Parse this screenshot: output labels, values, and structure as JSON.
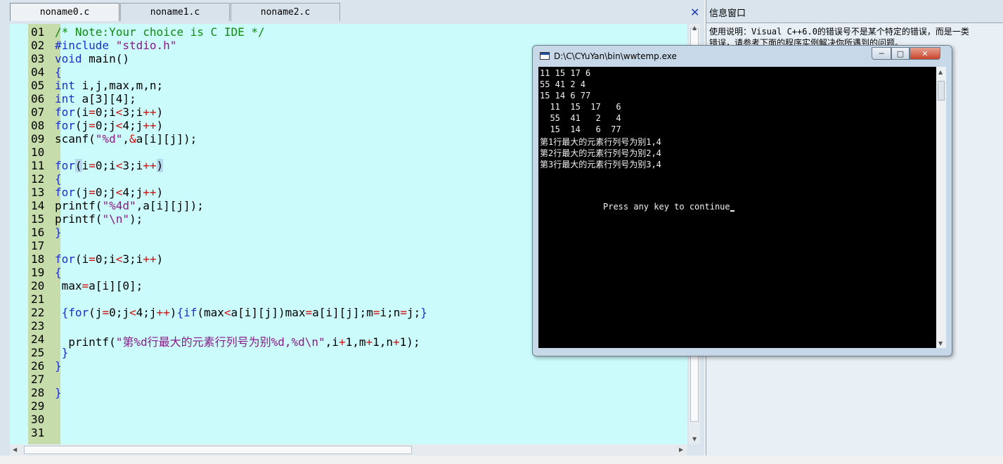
{
  "tabs": [
    {
      "label": "noname0.c"
    },
    {
      "label": "noname1.c"
    },
    {
      "label": "noname2.c"
    }
  ],
  "editor": {
    "line_numbers": [
      "01",
      "02",
      "03",
      "04",
      "05",
      "06",
      "07",
      "08",
      "09",
      "10",
      "11",
      "12",
      "13",
      "14",
      "15",
      "16",
      "17",
      "18",
      "19",
      "20",
      "21",
      "22",
      "23",
      "24",
      "25",
      "26",
      "27",
      "28",
      "29",
      "30",
      "31"
    ],
    "lines": [
      [
        {
          "t": "/* Note:Your choice is C IDE */",
          "c": "cm"
        }
      ],
      [
        {
          "t": "#include ",
          "c": "kw"
        },
        {
          "t": "\"stdio.h\"",
          "c": "str"
        }
      ],
      [
        {
          "t": "void",
          "c": "kw"
        },
        {
          "t": " main()",
          "c": "pl"
        }
      ],
      [
        {
          "t": "{",
          "c": "kw"
        }
      ],
      [
        {
          "t": "int",
          "c": "kw"
        },
        {
          "t": " i,j,max,m,n;",
          "c": "pl"
        }
      ],
      [
        {
          "t": "int",
          "c": "kw"
        },
        {
          "t": " a[3][4];",
          "c": "pl"
        }
      ],
      [
        {
          "t": "for",
          "c": "kw"
        },
        {
          "t": "(i",
          "c": "pl"
        },
        {
          "t": "=",
          "c": "op"
        },
        {
          "t": "0;i",
          "c": "pl"
        },
        {
          "t": "<",
          "c": "op"
        },
        {
          "t": "3;i",
          "c": "pl"
        },
        {
          "t": "++",
          "c": "op"
        },
        {
          "t": ")",
          "c": "pl"
        }
      ],
      [
        {
          "t": "for",
          "c": "kw"
        },
        {
          "t": "(j",
          "c": "pl"
        },
        {
          "t": "=",
          "c": "op"
        },
        {
          "t": "0;j",
          "c": "pl"
        },
        {
          "t": "<",
          "c": "op"
        },
        {
          "t": "4;j",
          "c": "pl"
        },
        {
          "t": "++",
          "c": "op"
        },
        {
          "t": ")",
          "c": "pl"
        }
      ],
      [
        {
          "t": "scanf(",
          "c": "pl"
        },
        {
          "t": "\"%d\"",
          "c": "str"
        },
        {
          "t": ",",
          "c": "pl"
        },
        {
          "t": "&",
          "c": "op"
        },
        {
          "t": "a[i][j]);",
          "c": "pl"
        }
      ],
      [],
      [
        {
          "t": "for",
          "c": "kw"
        },
        {
          "t": "(",
          "c": "hl"
        },
        {
          "t": "i",
          "c": "pl"
        },
        {
          "t": "=",
          "c": "op"
        },
        {
          "t": "0;i",
          "c": "pl"
        },
        {
          "t": "<",
          "c": "op"
        },
        {
          "t": "3;i",
          "c": "pl"
        },
        {
          "t": "++",
          "c": "op"
        },
        {
          "t": ")",
          "c": "hl"
        }
      ],
      [
        {
          "t": "{",
          "c": "kw"
        }
      ],
      [
        {
          "t": "for",
          "c": "kw"
        },
        {
          "t": "(j",
          "c": "pl"
        },
        {
          "t": "=",
          "c": "op"
        },
        {
          "t": "0;j",
          "c": "pl"
        },
        {
          "t": "<",
          "c": "op"
        },
        {
          "t": "4;j",
          "c": "pl"
        },
        {
          "t": "++",
          "c": "op"
        },
        {
          "t": ")",
          "c": "pl"
        }
      ],
      [
        {
          "t": "printf(",
          "c": "pl"
        },
        {
          "t": "\"%4d\"",
          "c": "str"
        },
        {
          "t": ",a[i][j]);",
          "c": "pl"
        }
      ],
      [
        {
          "t": "printf(",
          "c": "pl"
        },
        {
          "t": "\"\\n\"",
          "c": "str"
        },
        {
          "t": ");",
          "c": "pl"
        }
      ],
      [
        {
          "t": "}",
          "c": "kw"
        }
      ],
      [],
      [
        {
          "t": "for",
          "c": "kw"
        },
        {
          "t": "(i",
          "c": "pl"
        },
        {
          "t": "=",
          "c": "op"
        },
        {
          "t": "0;i",
          "c": "pl"
        },
        {
          "t": "<",
          "c": "op"
        },
        {
          "t": "3;i",
          "c": "pl"
        },
        {
          "t": "++",
          "c": "op"
        },
        {
          "t": ")",
          "c": "pl"
        }
      ],
      [
        {
          "t": "{",
          "c": "kw"
        }
      ],
      [
        {
          "t": " max",
          "c": "pl"
        },
        {
          "t": "=",
          "c": "op"
        },
        {
          "t": "a[i][0];",
          "c": "pl"
        }
      ],
      [],
      [
        {
          "t": " {",
          "c": "kw"
        },
        {
          "t": "for",
          "c": "kw"
        },
        {
          "t": "(j",
          "c": "pl"
        },
        {
          "t": "=",
          "c": "op"
        },
        {
          "t": "0;j",
          "c": "pl"
        },
        {
          "t": "<",
          "c": "op"
        },
        {
          "t": "4;j",
          "c": "pl"
        },
        {
          "t": "++",
          "c": "op"
        },
        {
          "t": ")",
          "c": "pl"
        },
        {
          "t": "{",
          "c": "kw"
        },
        {
          "t": "if",
          "c": "kw"
        },
        {
          "t": "(max",
          "c": "pl"
        },
        {
          "t": "<",
          "c": "op"
        },
        {
          "t": "a[i][j])max",
          "c": "pl"
        },
        {
          "t": "=",
          "c": "op"
        },
        {
          "t": "a[i][j];m",
          "c": "pl"
        },
        {
          "t": "=",
          "c": "op"
        },
        {
          "t": "i;n",
          "c": "pl"
        },
        {
          "t": "=",
          "c": "op"
        },
        {
          "t": "j;",
          "c": "pl"
        },
        {
          "t": "}",
          "c": "kw"
        }
      ],
      [],
      [
        {
          "t": "  printf(",
          "c": "pl"
        },
        {
          "t": "\"第%d行最大的元素行列号为别%d,%d\\n\"",
          "c": "str"
        },
        {
          "t": ",i",
          "c": "pl"
        },
        {
          "t": "+",
          "c": "op"
        },
        {
          "t": "1,m",
          "c": "pl"
        },
        {
          "t": "+",
          "c": "op"
        },
        {
          "t": "1,n",
          "c": "pl"
        },
        {
          "t": "+",
          "c": "op"
        },
        {
          "t": "1);",
          "c": "pl"
        }
      ],
      [
        {
          "t": " }",
          "c": "kw"
        }
      ],
      [
        {
          "t": "}",
          "c": "kw"
        }
      ],
      [],
      [
        {
          "t": "}",
          "c": "kw"
        }
      ],
      [],
      [],
      []
    ]
  },
  "info_panel": {
    "title": "信息窗口",
    "line1": "使用说明：Visual C++6.0的错误号不是某个特定的错误，而是一类",
    "line2": "错误，请参考下面的程序实例解决你所遇到的问题。"
  },
  "console": {
    "title": "D:\\C\\CYuYan\\bin\\wwtemp.exe",
    "minimize": "─",
    "maximize": "□",
    "close": "✕",
    "output": [
      "11 15 17 6",
      "55 41 2 4",
      "15 14 6 77",
      "  11  15  17   6",
      "  55  41   2   4",
      "  15  14   6  77",
      "第1行最大的元素行列号为别1,4",
      "第2行最大的元素行列号为别2,4",
      "第3行最大的元素行列号为别3,4"
    ],
    "prompt": "Press any key to continue"
  },
  "colors": {
    "editor_bg": "#cbfbfb",
    "gutter_bg": "#c7dcab",
    "keyword": "#1b2fd1",
    "comment": "#118a11",
    "string": "#8a1a8a",
    "operator": "#d21010"
  }
}
